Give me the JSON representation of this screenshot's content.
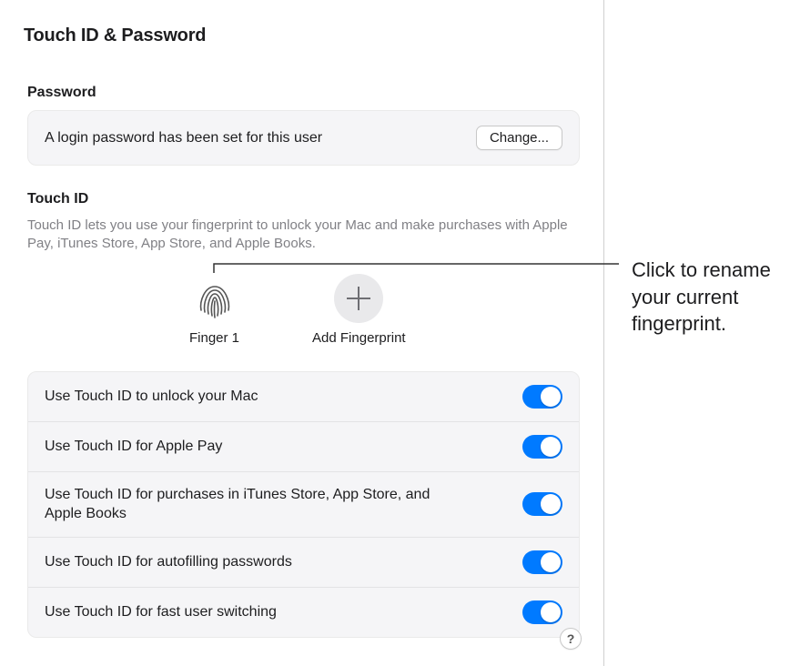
{
  "header": {
    "title": "Touch ID & Password"
  },
  "password": {
    "section_label": "Password",
    "description": "A login password has been set for this user",
    "change_button": "Change..."
  },
  "touchid": {
    "section_label": "Touch ID",
    "description": "Touch ID lets you use your fingerprint to unlock your Mac and make purchases with Apple Pay, iTunes Store, App Store, and Apple Books.",
    "fingerprints": [
      {
        "label": "Finger 1",
        "type": "registered"
      }
    ],
    "add_label": "Add Fingerprint"
  },
  "toggles": [
    {
      "label": "Use Touch ID to unlock your Mac",
      "on": true
    },
    {
      "label": "Use Touch ID for Apple Pay",
      "on": true
    },
    {
      "label": "Use Touch ID for purchases in iTunes Store, App Store, and Apple Books",
      "on": true
    },
    {
      "label": "Use Touch ID for autofilling passwords",
      "on": true
    },
    {
      "label": "Use Touch ID for fast user switching",
      "on": true
    }
  ],
  "help": {
    "glyph": "?"
  },
  "annotation": {
    "text": "Click to rename your current fingerprint."
  },
  "colors": {
    "accent": "#007aff",
    "secondary_text": "#808085",
    "panel_bg": "#f5f5f7"
  }
}
